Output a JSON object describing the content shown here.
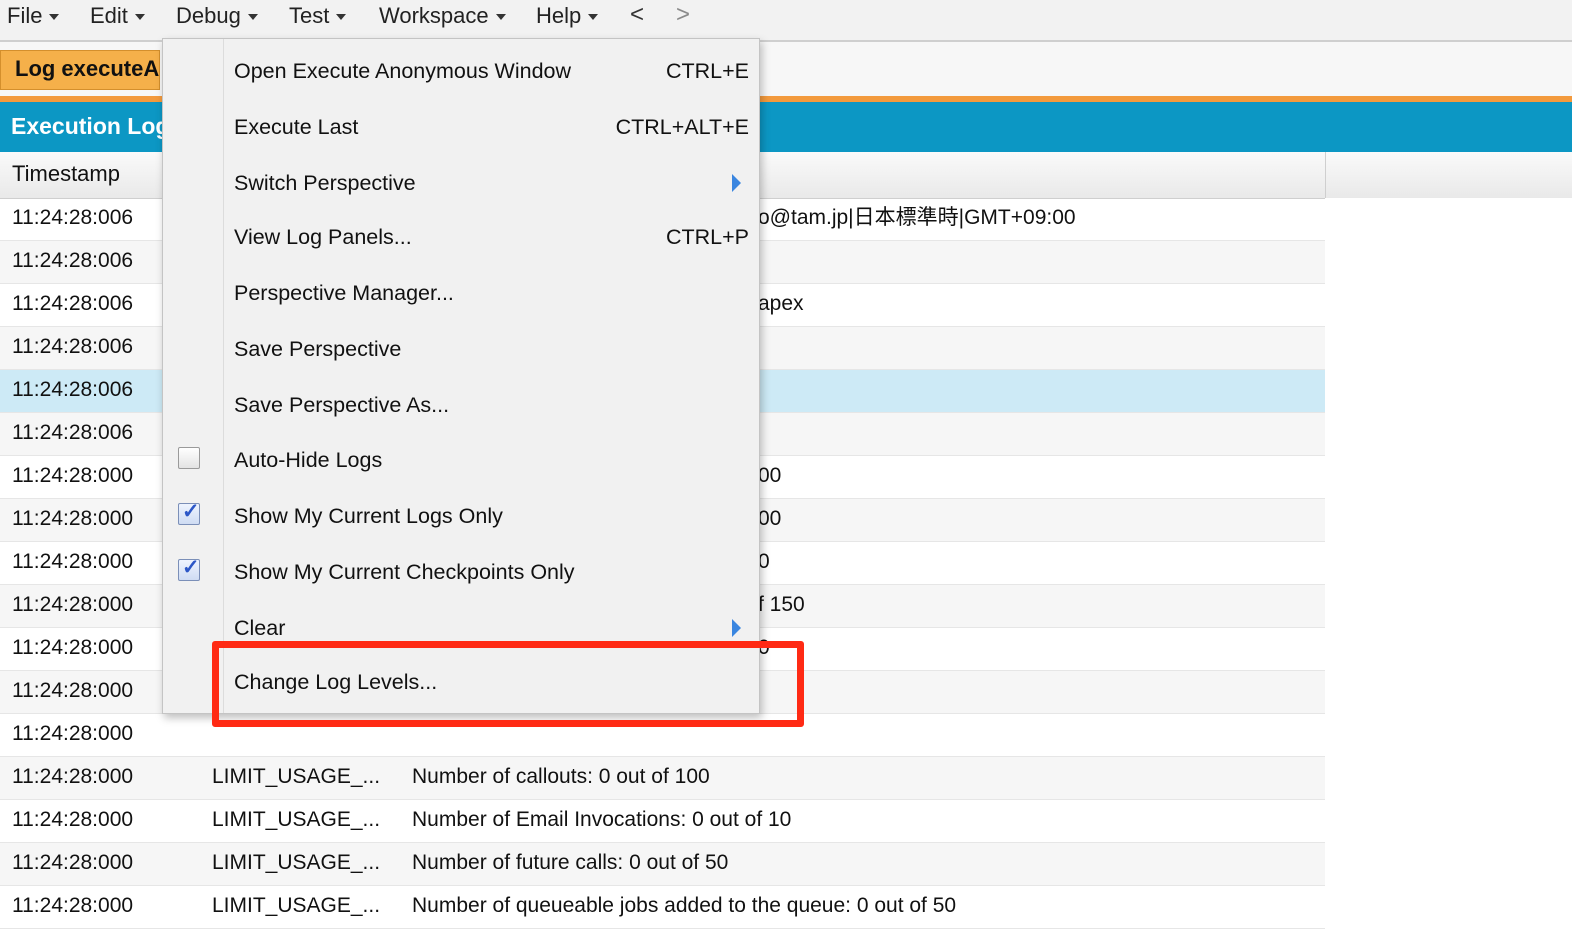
{
  "menubar": {
    "items": [
      {
        "label": "File"
      },
      {
        "label": "Edit"
      },
      {
        "label": "Debug"
      },
      {
        "label": "Test"
      },
      {
        "label": "Workspace"
      },
      {
        "label": "Help"
      }
    ],
    "back": "<",
    "forward": ">"
  },
  "tab": {
    "label": "Log executeAnonymous"
  },
  "panel": {
    "title": "Execution Log"
  },
  "table": {
    "column_timestamp": "Timestamp",
    "rows": [
      {
        "ts": "11:24:28:006",
        "event": "",
        "details": "",
        "frag": "o@tam.jp|日本標準時|GMT+09:00"
      },
      {
        "ts": "11:24:28:006",
        "event": "",
        "details": "",
        "frag": ""
      },
      {
        "ts": "11:24:28:006",
        "event": "",
        "details": "",
        "frag": "apex"
      },
      {
        "ts": "11:24:28:006",
        "event": "",
        "details": "",
        "frag": ""
      },
      {
        "ts": "11:24:28:006",
        "event": "",
        "details": "",
        "frag": ""
      },
      {
        "ts": "11:24:28:006",
        "event": "",
        "details": "",
        "frag": ""
      },
      {
        "ts": "11:24:28:000",
        "event": "",
        "details": "",
        "frag": "00"
      },
      {
        "ts": "11:24:28:000",
        "event": "",
        "details": "",
        "frag": "00"
      },
      {
        "ts": "11:24:28:000",
        "event": "",
        "details": "",
        "frag": "0"
      },
      {
        "ts": "11:24:28:000",
        "event": "",
        "details": "",
        "frag": "f 150"
      },
      {
        "ts": "11:24:28:000",
        "event": "",
        "details": "",
        "frag": "0"
      },
      {
        "ts": "11:24:28:000",
        "event": "",
        "details": "",
        "frag": ""
      },
      {
        "ts": "11:24:28:000",
        "event": "",
        "details": "",
        "frag": ""
      },
      {
        "ts": "11:24:28:000",
        "event": "LIMIT_USAGE_...",
        "details": "Number of callouts: 0 out of 100",
        "frag": ""
      },
      {
        "ts": "11:24:28:000",
        "event": "LIMIT_USAGE_...",
        "details": "Number of Email Invocations: 0 out of 10",
        "frag": ""
      },
      {
        "ts": "11:24:28:000",
        "event": "LIMIT_USAGE_...",
        "details": "Number of future calls: 0 out of 50",
        "frag": ""
      },
      {
        "ts": "11:24:28:000",
        "event": "LIMIT_USAGE_...",
        "details": "Number of queueable jobs added to the queue: 0 out of 50",
        "frag": ""
      }
    ]
  },
  "debug_menu": {
    "items": [
      {
        "label": "Open Execute Anonymous Window",
        "shortcut": "CTRL+E"
      },
      {
        "label": "Execute Last",
        "shortcut": "CTRL+ALT+E"
      },
      {
        "label": "Switch Perspective",
        "shortcut": ""
      },
      {
        "label": "View Log Panels...",
        "shortcut": "CTRL+P"
      },
      {
        "label": "Perspective Manager...",
        "shortcut": ""
      },
      {
        "label": "Save Perspective",
        "shortcut": ""
      },
      {
        "label": "Save Perspective As...",
        "shortcut": ""
      },
      {
        "label": "Auto-Hide Logs",
        "shortcut": "",
        "checked": false
      },
      {
        "label": "Show My Current Logs Only",
        "shortcut": "",
        "checked": true
      },
      {
        "label": "Show My Current Checkpoints Only",
        "shortcut": "",
        "checked": true
      },
      {
        "label": "Clear",
        "shortcut": ""
      },
      {
        "label": "Change Log Levels...",
        "shortcut": ""
      }
    ],
    "check_glyph": "✓"
  },
  "colors": {
    "tab_orange": "#f5b04a",
    "panel_blue": "#0c97c4",
    "selected_row": "#cdeaf6",
    "highlight_red": "#ff2a14",
    "submenu_arrow": "#3a86e0"
  }
}
